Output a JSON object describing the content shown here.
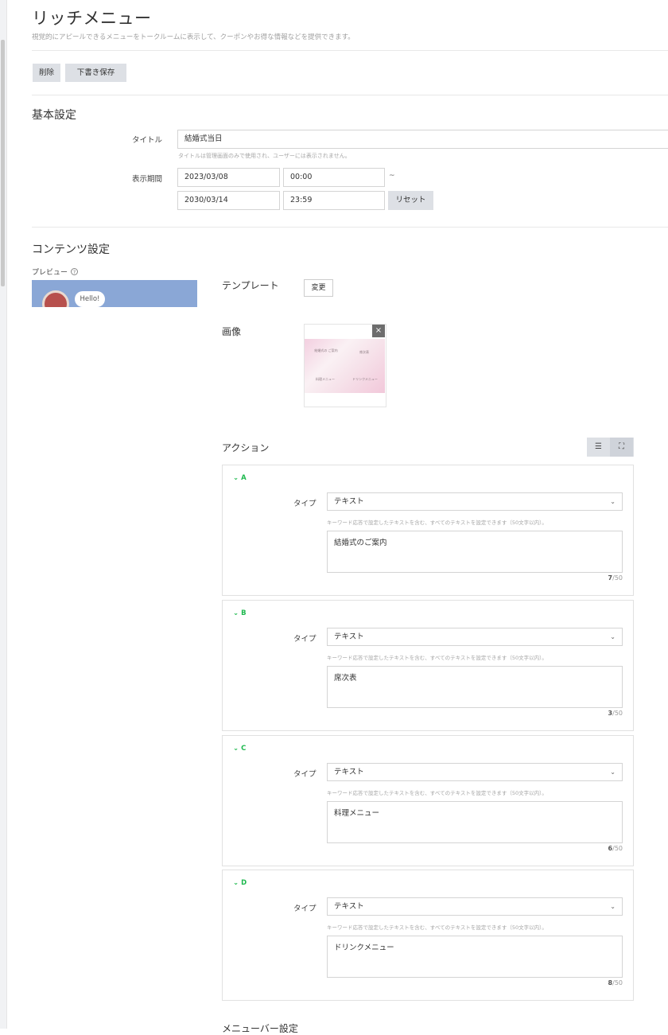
{
  "header": {
    "title": "リッチメニュー",
    "description": "視覚的にアピールできるメニューをトークルームに表示して、クーポンやお得な情報などを提供できます。"
  },
  "toolbar": {
    "delete_label": "削除",
    "save_draft_label": "下書き保存"
  },
  "basic": {
    "section_title": "基本設定",
    "title_label": "タイトル",
    "title_value": "結婚式当日",
    "title_hint": "タイトルは管理画面のみで使用され、ユーザーには表示されません。",
    "period_label": "表示期間",
    "start_date": "2023/03/08",
    "start_time": "00:00",
    "tilde": "~",
    "end_date": "2030/03/14",
    "end_time": "23:59",
    "reset_label": "リセット"
  },
  "content": {
    "section_title": "コンテンツ設定",
    "preview_label": "プレビュー",
    "help_glyph": "?",
    "preview_bubble": "Hello!",
    "template_label": "テンプレート",
    "change_label": "変更",
    "image_label": "画像",
    "close_glyph": "×",
    "image_cells": [
      "結婚式の ご案内",
      "席次表",
      "料理メニュー",
      "ドリンクメニュー"
    ],
    "action_label": "アクション",
    "list_view_glyph": "☰",
    "fullscreen_glyph": "⛶"
  },
  "actions": [
    {
      "letter": "A",
      "type_label": "タイプ",
      "type_value": "テキスト",
      "hint": "キーワード応答で設定したテキストを含む、すべてのテキストを設定できます（50文字以内）。",
      "text": "結婚式のご案内",
      "count": "7",
      "max": "/50"
    },
    {
      "letter": "B",
      "type_label": "タイプ",
      "type_value": "テキスト",
      "hint": "キーワード応答で設定したテキストを含む、すべてのテキストを設定できます（50文字以内）。",
      "text": "席次表",
      "count": "3",
      "max": "/50"
    },
    {
      "letter": "C",
      "type_label": "タイプ",
      "type_value": "テキスト",
      "hint": "キーワード応答で設定したテキストを含む、すべてのテキストを設定できます（50文字以内）。",
      "text": "料理メニュー",
      "count": "6",
      "max": "/50"
    },
    {
      "letter": "D",
      "type_label": "タイプ",
      "type_value": "テキスト",
      "hint": "キーワード応答で設定したテキストを含む、すべてのテキストを設定できます（50文字以内）。",
      "text": "ドリンクメニュー",
      "count": "8",
      "max": "/50"
    }
  ],
  "footer": {
    "next_section_partial": "メニューバー設定"
  },
  "colors": {
    "accent_green": "#1fb94f",
    "button_grey": "#dde0e5",
    "preview_blue": "#8aa7d6"
  }
}
